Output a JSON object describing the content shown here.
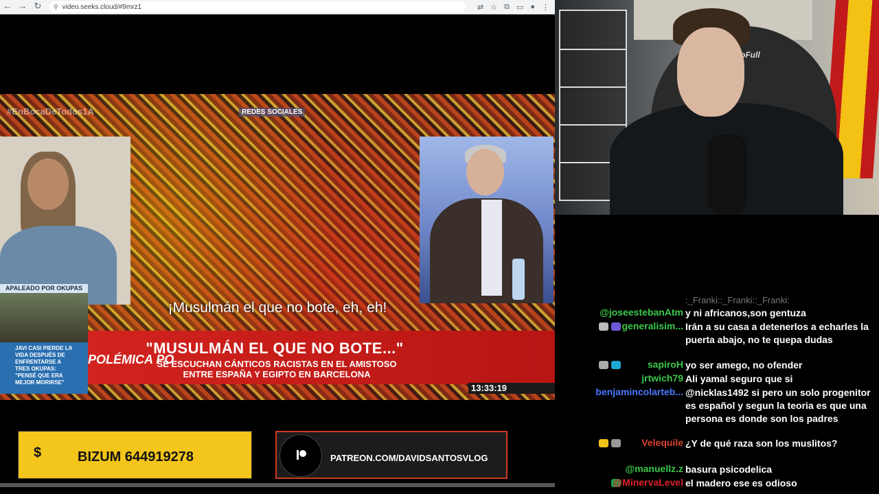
{
  "browser": {
    "url": "video.seeks.cloud/#9mrz1"
  },
  "video": {
    "hashtag": "#EnBocaDeTodos1A",
    "source_label": "REDES SOCIALES",
    "side_label": "APALEADO POR OKUPAS",
    "side_story": "JAVI CASI PIERDE LA VIDA DESPUÉS DE ENFRENTARSE A TRES OKUPAS: \"PENSÉ QUE ERA MEJOR MORIRSE\"",
    "subtitle": "¡Musulmán el que no bote, eh, eh!",
    "band_left": "POLÉMICA PO",
    "headline": "\"MUSULMÁN EL QUE NO BOTE...\"",
    "subheadline": "SE ESCUCHAN CÁNTICOS RACISTAS EN EL AMISTOSO ENTRE ESPAÑA Y EGIPTO EN BARCELONA",
    "timestamp": "13:33:19"
  },
  "banners": {
    "bizum_symbol": "$",
    "bizum_text": "BIZUM 644919278",
    "patreon_text": "PATREON.COM/DAVIDSANTOSVLOG"
  },
  "webcam": {
    "chair_brand": "oFull"
  },
  "chat": {
    "top_faded": ":_Franki::_Franki::_Franki:",
    "messages": [
      {
        "user": "@joseestebanAtm",
        "color": "#3cc84a",
        "text": "y ni africanos,son gentuza"
      },
      {
        "user": "generalisim...",
        "color": "#3cc84a",
        "text": "Irán a su casa a detenerlos a echarles la puerta abajo, no te quepa dudas"
      },
      {
        "user": "sapiroH",
        "color": "#3cc84a",
        "text": "yo ser amego, no ofender"
      },
      {
        "user": "jrtwich79",
        "color": "#3cc84a",
        "text": "Ali yamal seguro que si"
      },
      {
        "user": "benjamincolarteb...",
        "color": "#4a78ff",
        "text": "@nicklas1492 si pero un solo progenitor es español y segun la teoria es que una persona es donde son los padres"
      },
      {
        "user": "Velequile",
        "color": "#d8432e",
        "text": "¿Y de qué raza son los muslitos?"
      },
      {
        "user": "@manuellz.z",
        "color": "#3cc84a",
        "text": "basura psicodelica"
      },
      {
        "user": "@MinervaLevel",
        "color": "#e0202a",
        "text": "el madero ese es odioso"
      }
    ]
  }
}
